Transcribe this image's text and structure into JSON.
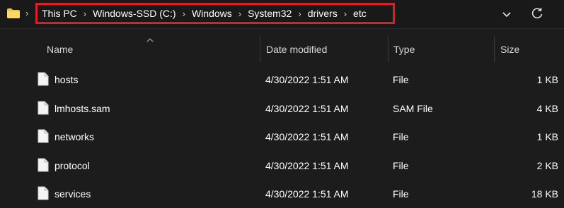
{
  "address_bar": {
    "breadcrumbs": [
      "This PC",
      "Windows-SSD (C:)",
      "Windows",
      "System32",
      "drivers",
      "etc"
    ],
    "highlight_color": "#e01c24",
    "icons": [
      "folder-icon",
      "chevron-right-icon",
      "chevron-down-icon",
      "refresh-icon"
    ]
  },
  "columns": {
    "name": "Name",
    "date_modified": "Date modified",
    "type": "Type",
    "size": "Size"
  },
  "files": [
    {
      "name": "hosts",
      "date_modified": "4/30/2022 1:51 AM",
      "type": "File",
      "size": "1 KB"
    },
    {
      "name": "lmhosts.sam",
      "date_modified": "4/30/2022 1:51 AM",
      "type": "SAM File",
      "size": "4 KB"
    },
    {
      "name": "networks",
      "date_modified": "4/30/2022 1:51 AM",
      "type": "File",
      "size": "1 KB"
    },
    {
      "name": "protocol",
      "date_modified": "4/30/2022 1:51 AM",
      "type": "File",
      "size": "2 KB"
    },
    {
      "name": "services",
      "date_modified": "4/30/2022 1:51 AM",
      "type": "File",
      "size": "18 KB"
    }
  ],
  "colors": {
    "background": "#1c1c1c",
    "text": "#ffffff",
    "folder": "#f4c542"
  }
}
